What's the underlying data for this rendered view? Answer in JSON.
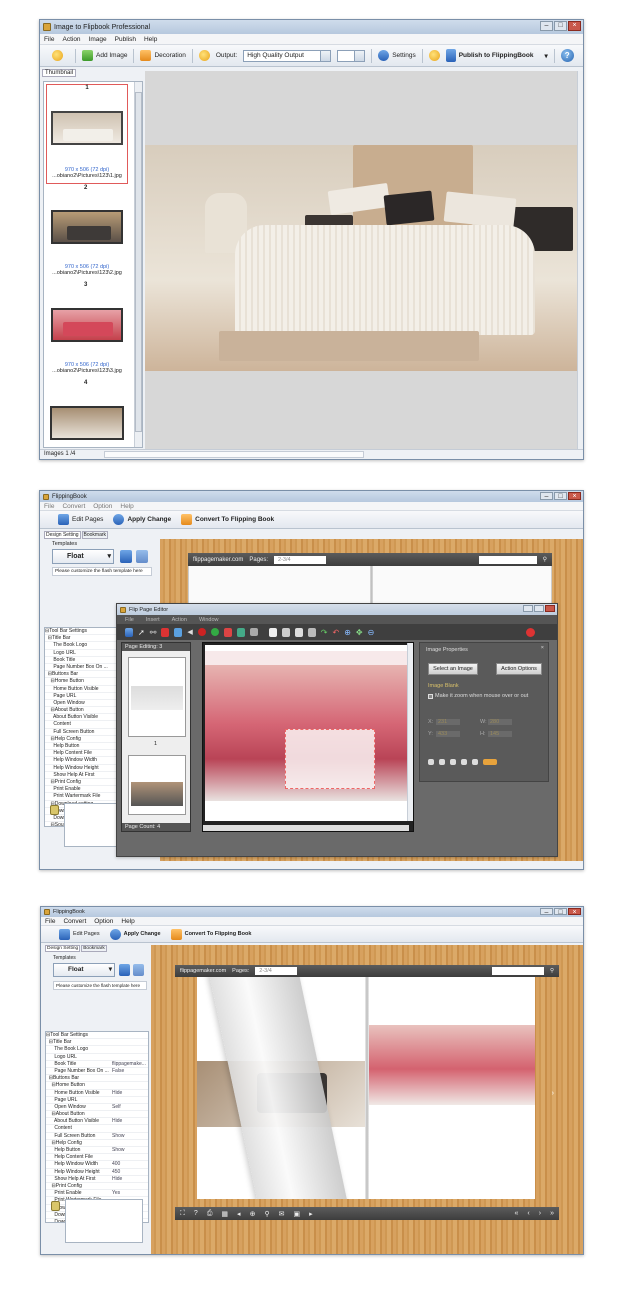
{
  "screen1": {
    "title": "Image to Flipbook Professional",
    "menus": [
      "File",
      "Action",
      "Image",
      "Publish",
      "Help"
    ],
    "toolbar": {
      "add_image": "Add Image",
      "decoration": "Decoration",
      "output_label": "Output:",
      "output_value": "High Quality Output",
      "settings": "Settings",
      "publish": "Publish to FlippingBook"
    },
    "thumbnail_tab": "Thumbnail",
    "thumbs": [
      {
        "num": "1",
        "dims": "970 x 506 (72 dpi)",
        "path": "...obiano2\\Pictures\\123\\1.jpg"
      },
      {
        "num": "2",
        "dims": "970 x 506 (72 dpi)",
        "path": "...obiano2\\Pictures\\123\\2.jpg"
      },
      {
        "num": "3",
        "dims": "970 x 506 (72 dpi)",
        "path": "...obiano2\\Pictures\\123\\3.jpg"
      },
      {
        "num": "4",
        "dims": "",
        "path": ""
      }
    ],
    "status": "Images 1 /4"
  },
  "screen2": {
    "title": "FlippingBook",
    "menus": [
      "File",
      "Convert",
      "Option",
      "Help"
    ],
    "toolbar": {
      "edit_pages": "Edit Pages",
      "apply_change": "Apply Change",
      "convert": "Convert To Flipping Book"
    },
    "tabs": [
      "Design Setting",
      "Bookmark"
    ],
    "templates_label": "Templates",
    "template_name": "Float",
    "customize": "Please customize the flash template here",
    "props": [
      [
        "⊟Tool Bar Settings",
        ""
      ],
      [
        "  ⊟Title Bar",
        ""
      ],
      [
        "      The Book Logo",
        ""
      ],
      [
        "      Logo URL",
        ""
      ],
      [
        "      Book Title",
        ""
      ],
      [
        "      Page Number Box On ...",
        ""
      ],
      [
        "  ⊟Buttons Bar",
        ""
      ],
      [
        "    ⊟Home Button",
        ""
      ],
      [
        "      Home Button Visible",
        ""
      ],
      [
        "      Page URL",
        ""
      ],
      [
        "      Open Window",
        ""
      ],
      [
        "    ⊟About Button",
        ""
      ],
      [
        "      About Button Visible",
        ""
      ],
      [
        "      Content",
        ""
      ],
      [
        "      Full Screen Button",
        ""
      ],
      [
        "    ⊟Help Config",
        ""
      ],
      [
        "      Help Button",
        ""
      ],
      [
        "      Help Content File",
        ""
      ],
      [
        "      Help Window Width",
        ""
      ],
      [
        "      Help Window Height",
        ""
      ],
      [
        "      Show Help At First",
        ""
      ],
      [
        "    ⊟Print Config",
        ""
      ],
      [
        "      Print Enable",
        ""
      ],
      [
        "      Print Wartermark File",
        ""
      ],
      [
        "    ⊟Download setting",
        ""
      ],
      [
        "      Download Enable",
        ""
      ],
      [
        "      Download URL",
        ""
      ],
      [
        "    ⊟Sound",
        ""
      ]
    ],
    "site": "flippagemaker.com",
    "pages_label": "Pages:",
    "pages_value": "2-3/4",
    "editor": {
      "title": "Flip Page Editor",
      "menus": [
        "File",
        "Insert",
        "Action",
        "Window"
      ],
      "page_editing": "Page Editing: 3",
      "page_num": "1",
      "page_count": "Page Count: 4",
      "props_title": "Image Properties",
      "select_image": "Select an Image",
      "action_options": "Action Options",
      "image_blank": "Image Blank",
      "zoom_check": "Make it zoom when mouse over or out",
      "x_label": "X:",
      "x_val": "231",
      "w_label": "W:",
      "w_val": "280",
      "y_label": "Y:",
      "y_val": "433",
      "h_label": "H:",
      "h_val": "145"
    }
  },
  "screen3": {
    "title": "FlippingBook",
    "menus": [
      "File",
      "Convert",
      "Option",
      "Help"
    ],
    "toolbar": {
      "edit_pages": "Edit Pages",
      "apply_change": "Apply Change",
      "convert": "Convert To Flipping Book"
    },
    "tabs": [
      "Design Setting",
      "Bookmark"
    ],
    "templates_label": "Templates",
    "template_name": "Float",
    "customize": "Please customize the flash template here",
    "props": [
      [
        "⊟Tool Bar Settings",
        ""
      ],
      [
        "  ⊟Title Bar",
        ""
      ],
      [
        "      The Book Logo",
        ""
      ],
      [
        "      Logo URL",
        ""
      ],
      [
        "      Book Title",
        "flippagemake..."
      ],
      [
        "      Page Number Box On ...",
        "False"
      ],
      [
        "  ⊟Buttons Bar",
        ""
      ],
      [
        "    ⊟Home Button",
        ""
      ],
      [
        "      Home Button Visible",
        "Hide"
      ],
      [
        "      Page URL",
        ""
      ],
      [
        "      Open Window",
        "Self"
      ],
      [
        "    ⊟About Button",
        ""
      ],
      [
        "      About Button Visible",
        "Hide"
      ],
      [
        "      Content",
        ""
      ],
      [
        "      Full Screen Button",
        "Show"
      ],
      [
        "    ⊟Help Config",
        ""
      ],
      [
        "      Help Button",
        "Show"
      ],
      [
        "      Help Content File",
        ""
      ],
      [
        "      Help Window Width",
        "400"
      ],
      [
        "      Help Window Height",
        "450"
      ],
      [
        "      Show Help At First",
        "Hide"
      ],
      [
        "    ⊟Print Config",
        ""
      ],
      [
        "      Print Enable",
        "Yes"
      ],
      [
        "      Print Wartermark File",
        ""
      ],
      [
        "    ⊟Download setting",
        ""
      ],
      [
        "      Download Enable",
        "No"
      ],
      [
        "      Download URL",
        ""
      ],
      [
        "    ⊟Sound",
        ""
      ],
      [
        "      Enable Sound",
        "Enable"
      ]
    ],
    "site": "flippagemaker.com",
    "pages_label": "Pages:",
    "pages_value": "2-3/4"
  }
}
